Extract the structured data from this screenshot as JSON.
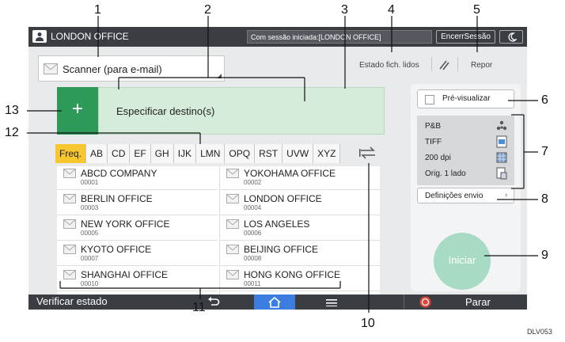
{
  "topbar": {
    "office_title": "LONDON OFFICE",
    "session_status": "Com sessão iniciada:[LONDON OFFICE]",
    "logout_label": "EncerrSessão"
  },
  "scanner": {
    "label": "Scanner (para e-mail)"
  },
  "toolbar": {
    "status_reading": "Estado fich. lidos",
    "reset_label": "Repor"
  },
  "destination": {
    "label": "Especificar destino(s)"
  },
  "tabs": [
    "Freq.",
    "AB",
    "CD",
    "EF",
    "GH",
    "IJK",
    "LMN",
    "OPQ",
    "RST",
    "UVW",
    "XYZ"
  ],
  "entries": [
    {
      "name": "ABCD COMPANY",
      "number": "00001"
    },
    {
      "name": "YOKOHAMA OFFICE",
      "number": "00002"
    },
    {
      "name": "BERLIN OFFICE",
      "number": "00003"
    },
    {
      "name": "LONDON OFFICE",
      "number": "00004"
    },
    {
      "name": "NEW YORK OFFICE",
      "number": "00005"
    },
    {
      "name": "LOS ANGELES",
      "number": "00006"
    },
    {
      "name": "KYOTO OFFICE",
      "number": "00007"
    },
    {
      "name": "BEIJING OFFICE",
      "number": "00008"
    },
    {
      "name": "SHANGHAI  OFFICE",
      "number": "00010"
    },
    {
      "name": "HONG KONG OFFICE",
      "number": "00011"
    }
  ],
  "side": {
    "preview_label": "Pré-visualizar",
    "settings": [
      "P&B",
      "TIFF",
      "200 dpi",
      "Orig. 1 lado"
    ],
    "send_settings_label": "Definições envio",
    "start_label": "Iniciar"
  },
  "bottombar": {
    "check_status": "Verificar estado",
    "stop_label": "Parar"
  },
  "callouts": [
    "1",
    "2",
    "3",
    "4",
    "5",
    "6",
    "7",
    "8",
    "9",
    "10",
    "11",
    "12",
    "13"
  ],
  "caption": "DLV053",
  "colors": {
    "add_button": "#2e9a5a",
    "destination_field": "#d4ecd9",
    "selected_tab": "#f8c62f",
    "start_button": "#a8dbc3",
    "home_button": "#3b7de0",
    "stop_icon": "#e0453a"
  }
}
